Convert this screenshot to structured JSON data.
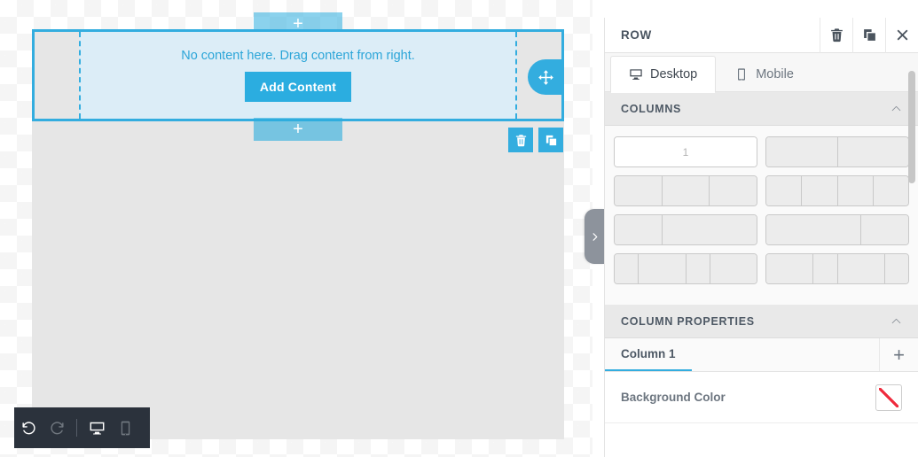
{
  "canvas": {
    "empty_message": "No content here. Drag content from right.",
    "add_content_label": "Add Content",
    "add_row_top_label": "+",
    "add_row_bottom_label": "+",
    "move_handle_icon": "move-arrows-icon",
    "row_delete_icon": "trash-icon",
    "row_duplicate_icon": "duplicate-icon"
  },
  "bottom_toolbar": {
    "undo_icon": "undo-icon",
    "redo_icon": "redo-icon",
    "desktop_icon": "desktop-icon",
    "mobile_icon": "mobile-icon"
  },
  "collapse_tab": {
    "icon": "chevron-right-icon"
  },
  "panel": {
    "title": "ROW",
    "header_actions": [
      {
        "name": "delete",
        "icon": "trash-icon"
      },
      {
        "name": "duplicate",
        "icon": "duplicate-icon"
      },
      {
        "name": "close",
        "icon": "close-icon"
      }
    ],
    "tabs": [
      {
        "label": "Desktop",
        "icon": "desktop-icon",
        "active": true
      },
      {
        "label": "Mobile",
        "icon": "mobile-icon",
        "active": false
      }
    ],
    "sections": {
      "columns": {
        "title": "COLUMNS",
        "collapsed": false,
        "chevron": "chevron-up-icon",
        "selected_index": 0,
        "selected_badge": "1",
        "layouts": [
          {
            "name": "1-column",
            "weights": [
              1
            ],
            "selected": true
          },
          {
            "name": "2-columns-equal",
            "weights": [
              1,
              1
            ],
            "selected": false
          },
          {
            "name": "3-columns-equal",
            "weights": [
              1,
              1,
              1
            ],
            "selected": false
          },
          {
            "name": "4-columns-equal",
            "weights": [
              1,
              1,
              1,
              1
            ],
            "selected": false
          },
          {
            "name": "2-columns-1-2",
            "weights": [
              1,
              2
            ],
            "selected": false
          },
          {
            "name": "2-columns-2-1",
            "weights": [
              2,
              1
            ],
            "selected": false
          },
          {
            "name": "4-columns-narrow-wide",
            "weights": [
              1,
              2,
              1,
              2
            ],
            "selected": false
          },
          {
            "name": "4-columns-wide-narrow",
            "weights": [
              2,
              1,
              2,
              1
            ],
            "selected": false
          }
        ]
      },
      "column_properties": {
        "title": "COLUMN PROPERTIES",
        "collapsed": false,
        "chevron": "chevron-up-icon",
        "active_tab": "Column 1",
        "add_column_label": "+",
        "rows": [
          {
            "label": "Background Color",
            "control": "color-swatch",
            "value": "none"
          }
        ]
      }
    }
  },
  "colors": {
    "accent": "#33addf",
    "accent_button": "#2bade0",
    "row_fill": "#dcedf7",
    "page_grey": "#e6e6e6",
    "panel_section_head": "#e9e9e9",
    "toolbar_dark": "#2b323c",
    "swatch_slash": "#ef2b3d"
  }
}
